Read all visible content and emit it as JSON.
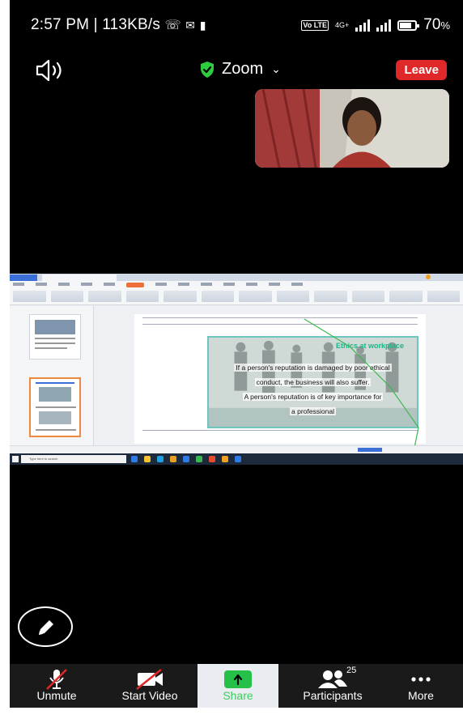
{
  "status_bar": {
    "time_speed": "2:57 PM | 113KB/s",
    "network_label": "4G+",
    "lte_label": "Vo LTE",
    "battery": "70",
    "battery_unit": "%",
    "battery_level": 0.7
  },
  "meeting": {
    "app_title": "Zoom",
    "leave_label": "Leave",
    "shield_color": "#2ecc40"
  },
  "shared_slide": {
    "heading": "Ethics at workplace",
    "line1": "If a person's reputation is damaged by poor ethical",
    "line2": "conduct, the business will also suffer.",
    "line3": "A person's reputation is of key importance for",
    "line4": "a professional"
  },
  "taskbar": {
    "search_placeholder": "Type here to search"
  },
  "toolbar": {
    "unmute": "Unmute",
    "start_video": "Start Video",
    "share": "Share",
    "participants": "Participants",
    "participants_count": "25",
    "more": "More"
  },
  "colors": {
    "leave": "#e02828",
    "share_green": "#25c047",
    "accent_orange": "#ef6f3b"
  }
}
